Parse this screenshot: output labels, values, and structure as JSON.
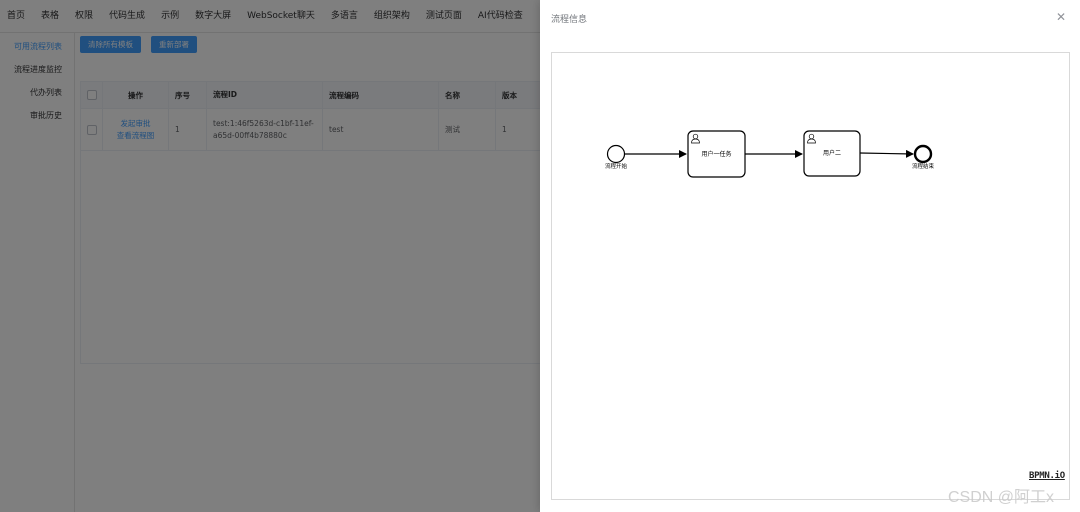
{
  "topnav": {
    "items": [
      "首页",
      "表格",
      "权限",
      "代码生成",
      "示例",
      "数字大屏",
      "WebSocket聊天",
      "多语言",
      "组织架构",
      "测试页面",
      "AI代码检查"
    ]
  },
  "sidemenu": {
    "items": [
      "可用流程列表",
      "流程进度监控",
      "代办列表",
      "审批历史"
    ],
    "active_index": 0
  },
  "toolbar": {
    "clear_label": "清除所有模板",
    "redeploy_label": "重新部署"
  },
  "table": {
    "headers": [
      "操作",
      "序号",
      "流程ID",
      "流程编码",
      "名称",
      "版本"
    ],
    "rows": [
      {
        "actions": [
          "发起审批",
          "查看流程图"
        ],
        "seq": "1",
        "id": "test:1:46f5263d-c1bf-11ef-a65d-00ff4b78880c",
        "code": "test",
        "name": "测试",
        "version": "1"
      }
    ]
  },
  "drawer": {
    "title": "流程信息",
    "close_icon": "close-icon",
    "logo": "BPMN.iO"
  },
  "bpmn": {
    "start_label": "流程开始",
    "task1_label": "用户一任务",
    "task2_label": "用户二",
    "end_label": "流程结束"
  },
  "watermark": "CSDN @阿工x",
  "colors": {
    "primary": "#409eff",
    "overlay": "rgba(0,0,0,0.5)"
  }
}
